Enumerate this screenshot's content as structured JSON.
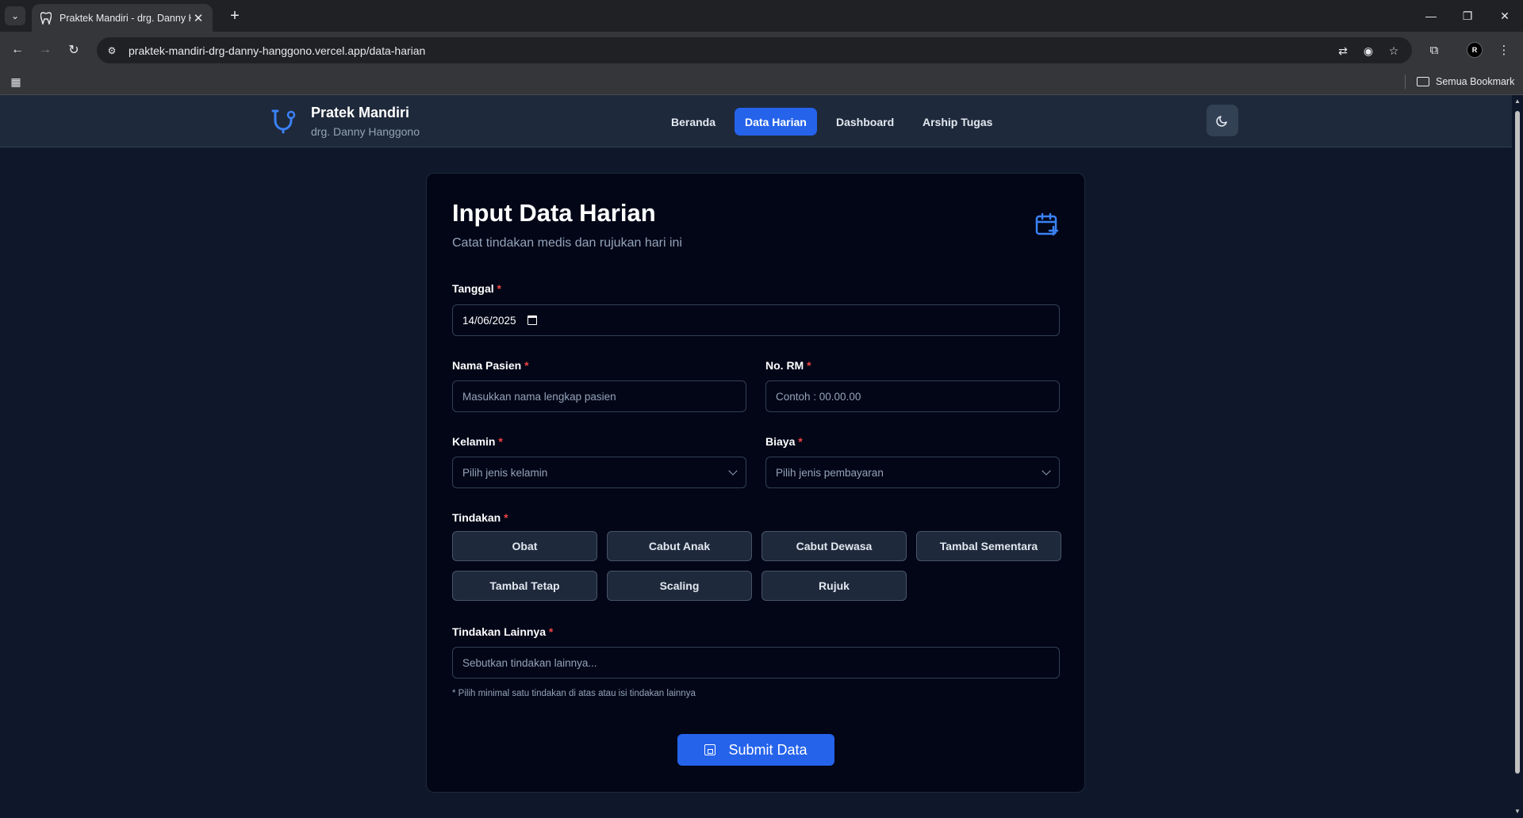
{
  "browser": {
    "tab_title": "Praktek Mandiri - drg. Danny Hanggono",
    "url": "praktek-mandiri-drg-danny-hanggono.vercel.app/data-harian",
    "bookmarks_label": "Semua Bookmark",
    "profile_initial": "R"
  },
  "app": {
    "brand_title": "Pratek Mandiri",
    "brand_subtitle": "drg. Danny Hanggono",
    "nav": [
      {
        "label": "Beranda",
        "active": false
      },
      {
        "label": "Data Harian",
        "active": true
      },
      {
        "label": "Dashboard",
        "active": false
      },
      {
        "label": "Arship Tugas",
        "active": false
      }
    ],
    "accent_color": "#2563eb"
  },
  "form": {
    "title": "Input Data Harian",
    "subtitle": "Catat tindakan medis dan rujukan hari ini",
    "tanggal": {
      "label": "Tanggal",
      "value": "14/06/2025"
    },
    "nama_pasien": {
      "label": "Nama Pasien",
      "placeholder": "Masukkan nama lengkap pasien"
    },
    "no_rm": {
      "label": "No. RM",
      "placeholder": "Contoh : 00.00.00"
    },
    "kelamin": {
      "label": "Kelamin",
      "placeholder": "Pilih jenis kelamin"
    },
    "biaya": {
      "label": "Biaya",
      "placeholder": "Pilih jenis pembayaran"
    },
    "tindakan": {
      "label": "Tindakan",
      "options": [
        "Obat",
        "Cabut Anak",
        "Cabut Dewasa",
        "Tambal Sementara",
        "Tambal Tetap",
        "Scaling",
        "Rujuk"
      ]
    },
    "tindakan_lainnya": {
      "label": "Tindakan Lainnya",
      "placeholder": "Sebutkan tindakan lainnya..."
    },
    "hint": "* Pilih minimal satu tindakan di atas atau isi tindakan lainnya",
    "required_mark": "*",
    "submit_label": "Submit Data"
  }
}
